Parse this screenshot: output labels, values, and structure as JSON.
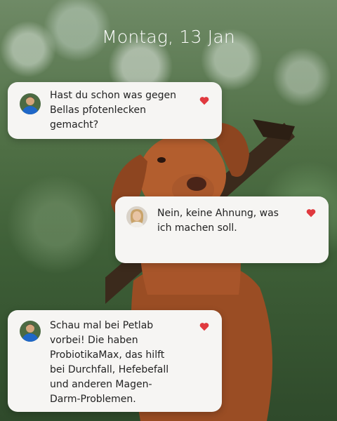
{
  "screen": {
    "date_label": "Montag, 13 Jan"
  },
  "messages": [
    {
      "sender": "male",
      "text_lines": [
        "Hast du schon was gegen",
        "Bellas pfotenlecken",
        "gemacht?"
      ],
      "liked": true
    },
    {
      "sender": "female",
      "text_lines": [
        "Nein, keine Ahnung, was",
        "ich machen soll."
      ],
      "liked": true
    },
    {
      "sender": "male",
      "text_lines": [
        "Schau mal bei Petlab",
        "vorbei! Die haben",
        "ProbiotikaMax, das hilft",
        "bei Durchfall, Hefebefall",
        "und anderen Magen-",
        "Darm-Problemen."
      ],
      "liked": true
    }
  ],
  "colors": {
    "heart": "#e0393e",
    "bubble": "#f6f5f3",
    "avatar_male_shirt": "#1f67c8",
    "avatar_female_bg": "#d9d2c8"
  },
  "icons": {
    "like": "heart-icon",
    "avatar_male": "user-avatar-male",
    "avatar_female": "user-avatar-female"
  }
}
